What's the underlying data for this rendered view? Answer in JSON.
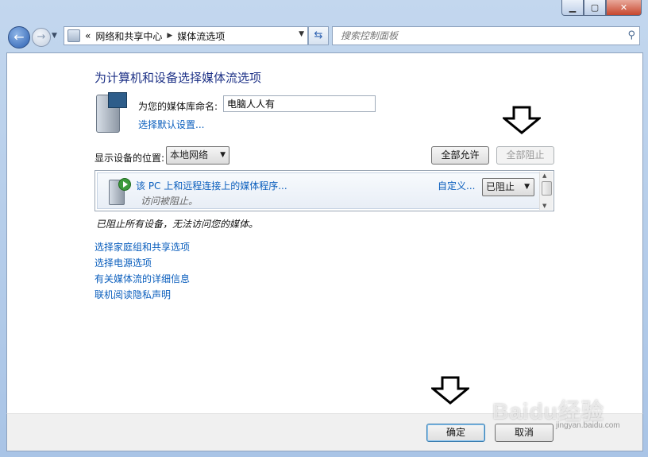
{
  "window": {
    "caption": {
      "minimize": "▁",
      "maximize": "▢",
      "close": "✕"
    }
  },
  "address_bar": {
    "breadcrumb_prefix": "«",
    "crumbs": [
      "网络和共享中心",
      "媒体流选项"
    ],
    "search_placeholder": "搜索控制面板"
  },
  "main": {
    "title": "为计算机和设备选择媒体流选项",
    "library_label": "为您的媒体库命名:",
    "library_name": "电脑人人有",
    "default_settings_link": "选择默认设置...",
    "location_label": "显示设备的位置:",
    "location_value": "本地网络",
    "allow_all": "全部允许",
    "block_all": "全部阻止",
    "device": {
      "name": "该 PC 上和远程连接上的媒体程序...",
      "status": "访问被阻止。",
      "customize": "自定义...",
      "permission": "已阻止"
    },
    "notice": "已阻止所有设备，无法访问您的媒体。",
    "links": [
      "选择家庭组和共享选项",
      "选择电源选项",
      "有关媒体流的详细信息",
      "联机阅读隐私声明"
    ]
  },
  "footer": {
    "ok": "确定",
    "cancel": "取消"
  },
  "watermark": {
    "logo": "Baidu经验",
    "sub": "jingyan.baidu.com"
  },
  "icons": [
    "back-arrow-icon",
    "forward-arrow-icon",
    "control-panel-icon",
    "refresh-icon",
    "search-icon",
    "media-library-icon",
    "media-device-icon",
    "down-arrow-annotation-icon"
  ]
}
